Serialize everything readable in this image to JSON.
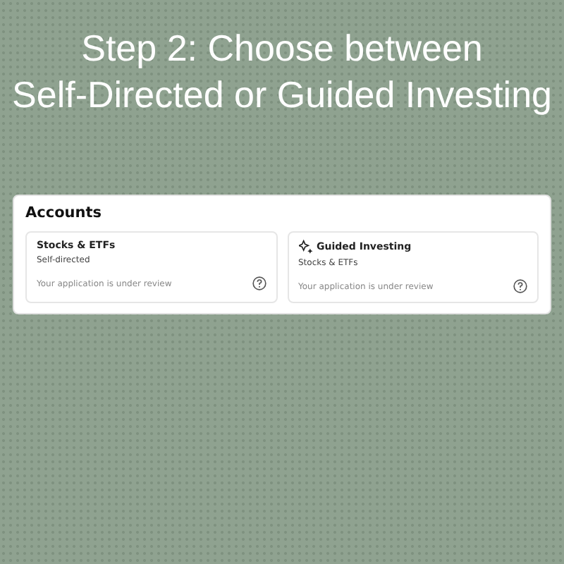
{
  "heading": [
    "Step 2: Choose between",
    "Self-Directed or Guided Investing"
  ],
  "panel": {
    "title": "Accounts",
    "accounts": [
      {
        "kind": "plain",
        "name": "Stocks & ETFs",
        "subtitle": "Self-directed",
        "status": "Your application is under review"
      },
      {
        "kind": "sparkle",
        "name": "Guided Investing",
        "subtitle": "Stocks & ETFs",
        "status": "Your application is under review"
      }
    ]
  }
}
